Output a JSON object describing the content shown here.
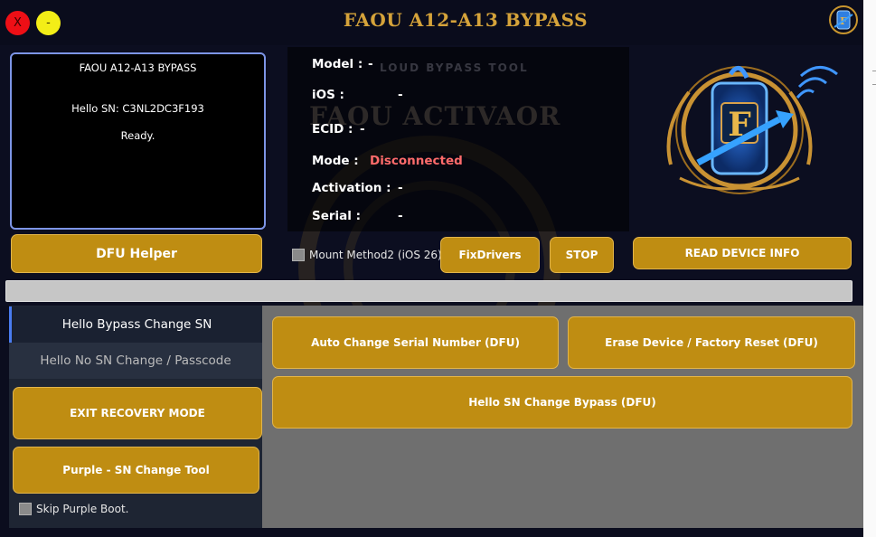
{
  "window": {
    "title": "FAOU A12-A13 BYPASS",
    "close_label": "X",
    "minimize_label": "-"
  },
  "log": {
    "line1": "FAOU A12-A13 BYPASS",
    "line2": "Hello SN: C3NL2DC3F193",
    "line3": "Ready."
  },
  "device_info": {
    "watermark_top": "LOUD BYPASS TOOL",
    "watermark_main": "FAOU ACTIVAOR",
    "model_label": "Model :",
    "model_value": "-",
    "ios_label": "iOS :",
    "ios_value": "-",
    "ecid_label": "ECID :",
    "ecid_value": "-",
    "mode_label": "Mode :",
    "mode_value": "Disconnected",
    "activation_label": "Activation :",
    "activation_value": "-",
    "serial_label": "Serial :",
    "serial_value": "-"
  },
  "logo": {
    "letter": "F"
  },
  "toolbar": {
    "dfu_helper": "DFU Helper",
    "mount_method": "Mount Method2 (iOS 26)",
    "fix_drivers": "FixDrivers",
    "stop": "STOP",
    "read_device_info": "READ DEVICE INFO"
  },
  "progress": {
    "value": 0
  },
  "tabs": {
    "active": "Hello Bypass Change SN",
    "inactive": "Hello No SN Change / Passcode"
  },
  "left_actions": {
    "exit_recovery": "EXIT RECOVERY MODE",
    "purple_tool": "Purple - SN Change Tool",
    "skip_purple": "Skip Purple Boot."
  },
  "actions": {
    "auto_change_serial": "Auto Change Serial Number (DFU)",
    "erase_device": "Erase Device / Factory Reset (DFU)",
    "hello_sn_bypass": "Hello SN Change Bypass (DFU)"
  },
  "colors": {
    "gold": "#bf8d12",
    "title_gold": "#d5a33a",
    "disconnected": "#ff6b6b",
    "active_tab_accent": "#4a7cf0"
  }
}
